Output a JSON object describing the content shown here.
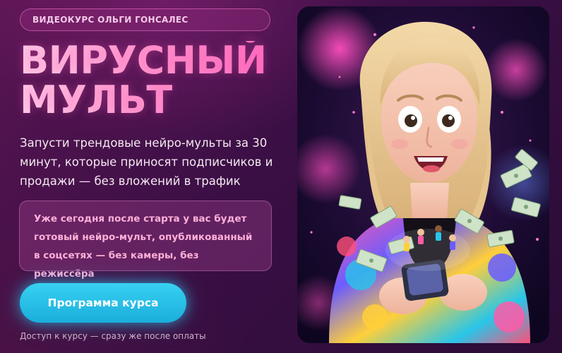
{
  "badge": {
    "label": "ВИДЕОКУРС ОЛЬГИ ГОНСАЛЕС"
  },
  "hero": {
    "title_line1": "ВИРУСНЫЙ",
    "title_line2": "МУЛЬТ",
    "description": "Запусти трендовые нейро-мульты за 30 минут, которые приносят подписчиков и продажи — без вложений в трафик",
    "note": "Уже сегодня после старта у вас будет готовый нейро-мульт, опубликованный в соцсетях — без камеры, без режиссёра"
  },
  "cta": {
    "label": "Программа курса",
    "color": "#1fb8e2"
  },
  "access_text": "Доступ к курсу — сразу же после оплаты",
  "illustration": {
    "subject": "cartoon-woman-with-phone-and-money-icon"
  },
  "colors": {
    "background": "#3b0f45",
    "title_gradient_start": "#ffd9ee",
    "title_gradient_end": "#ff6fbf",
    "note_text": "#ffb0d8"
  }
}
